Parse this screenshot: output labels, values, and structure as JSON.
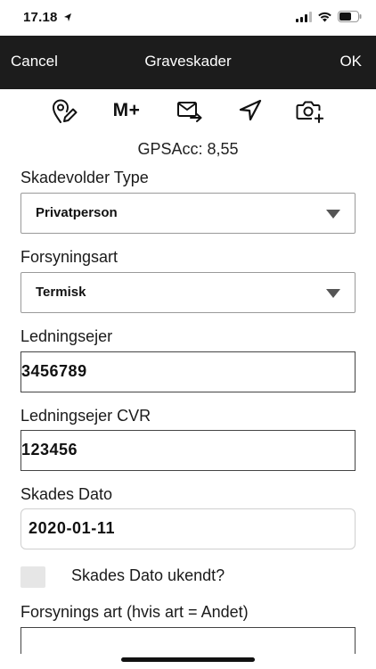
{
  "status_bar": {
    "time": "17.18",
    "location_arrow_icon": "location-arrow-icon",
    "signal_icon": "cellular-signal-icon",
    "wifi_icon": "wifi-icon",
    "battery_icon": "battery-icon"
  },
  "navbar": {
    "cancel_label": "Cancel",
    "title": "Graveskader",
    "ok_label": "OK",
    "background": "#1c1c1c"
  },
  "toolbar": {
    "items": [
      {
        "icon": "edit-location-pin-icon"
      },
      {
        "label": "M+"
      },
      {
        "icon": "send-mail-icon"
      },
      {
        "icon": "navigation-arrow-icon"
      },
      {
        "icon": "add-photo-camera-icon"
      }
    ]
  },
  "gps": {
    "text": "GPSAcc: 8,55"
  },
  "form": {
    "skadevolder_type": {
      "label": "Skadevolder Type",
      "value": "Privatperson"
    },
    "forsyningsart": {
      "label": "Forsyningsart",
      "value": "Termisk"
    },
    "ledningsejer": {
      "label": "Ledningsejer",
      "value": "3456789"
    },
    "ledningsejer_cvr": {
      "label": "Ledningsejer CVR",
      "value": "123456"
    },
    "skades_dato": {
      "label": "Skades Dato",
      "value": "2020-01-11"
    },
    "skades_dato_ukendt": {
      "label": "Skades Dato ukendt?",
      "checked": false
    },
    "forsynings_art_andet": {
      "label": "Forsynings art (hvis art = Andet)",
      "value": ""
    }
  }
}
